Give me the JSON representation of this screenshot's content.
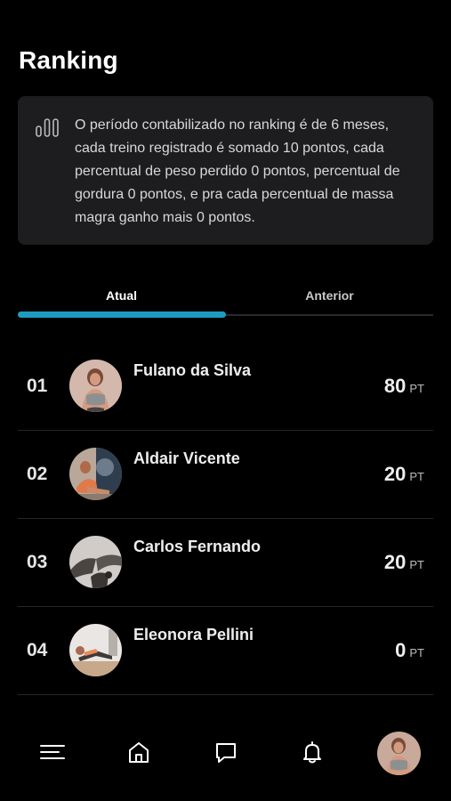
{
  "page": {
    "title": "Ranking"
  },
  "info": {
    "icon": "bar-chart-icon",
    "text": "O período contabilizado no ranking é de 6 meses, cada treino registrado é somado 10 pontos, cada percentual de peso perdido 0 pontos, percentual de gordura 0 pontos, e pra cada percentual de massa magra ganho mais 0 pontos."
  },
  "tabs": [
    {
      "label": "Atual",
      "active": true
    },
    {
      "label": "Anterior",
      "active": false
    }
  ],
  "ranking": [
    {
      "position": "01",
      "name": "Fulano da Silva",
      "points": "80",
      "unit": "PT"
    },
    {
      "position": "02",
      "name": "Aldair Vicente",
      "points": "20",
      "unit": "PT"
    },
    {
      "position": "03",
      "name": "Carlos Fernando",
      "points": "20",
      "unit": "PT"
    },
    {
      "position": "04",
      "name": "Eleonora Pellini",
      "points": "0",
      "unit": "PT"
    }
  ],
  "nav": {
    "items": [
      "menu-icon",
      "home-icon",
      "chat-icon",
      "bell-icon",
      "profile-avatar"
    ]
  },
  "colors": {
    "accent": "#1e9cc0",
    "background": "#000000",
    "card": "#1d1d1f"
  }
}
